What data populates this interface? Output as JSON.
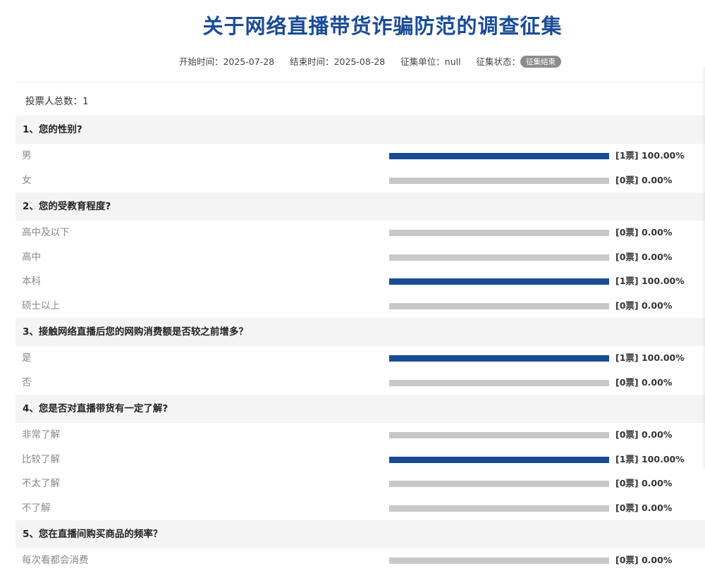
{
  "title": "关于网络直播带货诈骗防范的调查征集",
  "meta": {
    "start_label": "开始时间：",
    "start_value": "2025-07-28",
    "end_label": "结束时间：",
    "end_value": "2025-08-28",
    "unit_label": "征集单位：",
    "unit_value": "null",
    "status_label": "征集状态：",
    "status_badge": "征集结束"
  },
  "total_voters": "投票人总数：1",
  "colors": {
    "accent": "#1a4b95",
    "bar_empty": "#c8c8c8",
    "section_bg": "#f4f4f4"
  },
  "questions": [
    {
      "title": "1、您的性别?",
      "options": [
        {
          "label": "男",
          "stat": "[1票] 100.00%",
          "percent": 100
        },
        {
          "label": "女",
          "stat": "[0票] 0.00%",
          "percent": 0
        }
      ]
    },
    {
      "title": "2、您的受教育程度?",
      "options": [
        {
          "label": "高中及以下",
          "stat": "[0票] 0.00%",
          "percent": 0
        },
        {
          "label": "高中",
          "stat": "[0票] 0.00%",
          "percent": 0
        },
        {
          "label": "本科",
          "stat": "[1票] 100.00%",
          "percent": 100
        },
        {
          "label": "硕士以上",
          "stat": "[0票] 0.00%",
          "percent": 0
        }
      ]
    },
    {
      "title": "3、接触网络直播后您的网购消费额是否较之前增多？",
      "options": [
        {
          "label": "是",
          "stat": "[1票] 100.00%",
          "percent": 100
        },
        {
          "label": "否",
          "stat": "[0票] 0.00%",
          "percent": 0
        }
      ]
    },
    {
      "title": "4、您是否对直播带货有一定了解?",
      "options": [
        {
          "label": "非常了解",
          "stat": "[0票] 0.00%",
          "percent": 0
        },
        {
          "label": "比较了解",
          "stat": "[1票] 100.00%",
          "percent": 100
        },
        {
          "label": "不太了解",
          "stat": "[0票] 0.00%",
          "percent": 0
        },
        {
          "label": "不了解",
          "stat": "[0票] 0.00%",
          "percent": 0
        }
      ]
    },
    {
      "title": "5、您在直播间购买商品的频率？",
      "options": [
        {
          "label": "每次看都会消费",
          "stat": "[0票] 0.00%",
          "percent": 0
        }
      ]
    }
  ]
}
